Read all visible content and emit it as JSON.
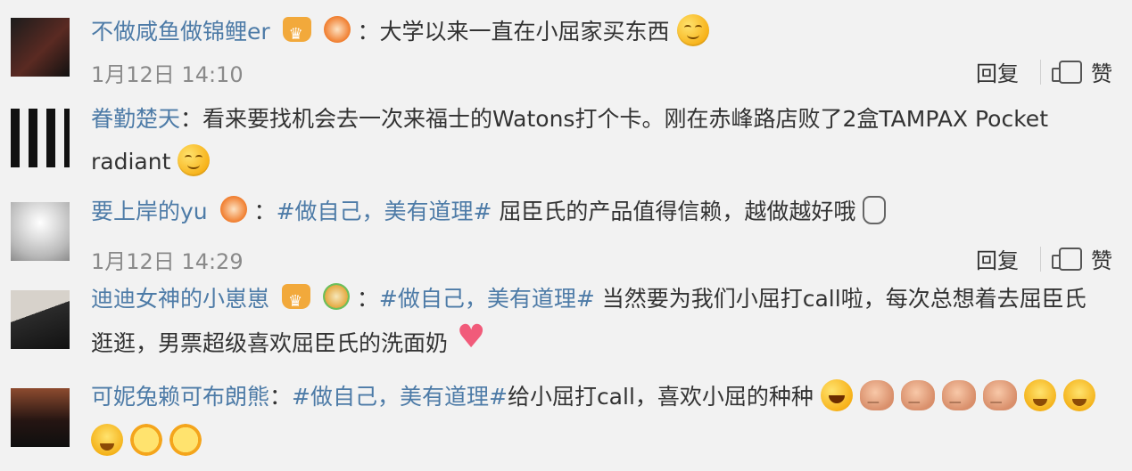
{
  "comments": [
    {
      "user": "不做咸鱼做锦鲤er",
      "text": "大学以来一直在小屈家买东西",
      "time": "1月12日 14:10",
      "reply": "回复",
      "like": "赞"
    },
    {
      "user": "眷勤楚天",
      "text_line1": "看来要找机会去一次来福士的Watons打个卡。刚在赤峰路店败了2盒TAMPAX Pocket",
      "text_line2": "radiant"
    },
    {
      "user": "要上岸的yu",
      "tag": "#做自己，美有道理#",
      "text": " 屈臣氏的产品值得信赖，越做越好哦",
      "time": "1月12日 14:29",
      "reply": "回复",
      "like": "赞"
    },
    {
      "user": "迪迪女神的小崽崽",
      "tag": "#做自己，美有道理#",
      "text_line1": " 当然要为我们小屈打call啦，每次总想着去屈臣氏",
      "text_line2": "逛逛，男票超级喜欢屈臣氏的洗面奶"
    },
    {
      "user": "可妮兔赖可布朗熊",
      "tag": "#做自己，美有道理#",
      "text": "给小屈打call，喜欢小屈的种种"
    }
  ],
  "colon": "：",
  "icons": {
    "avatar": "avatar",
    "smile": "smile-emoji-icon",
    "thumb": "thumbs-up-icon"
  },
  "colors": {
    "background": "#f2f2f2",
    "link": "#4d7ba7",
    "meta": "#8a8a8a"
  }
}
